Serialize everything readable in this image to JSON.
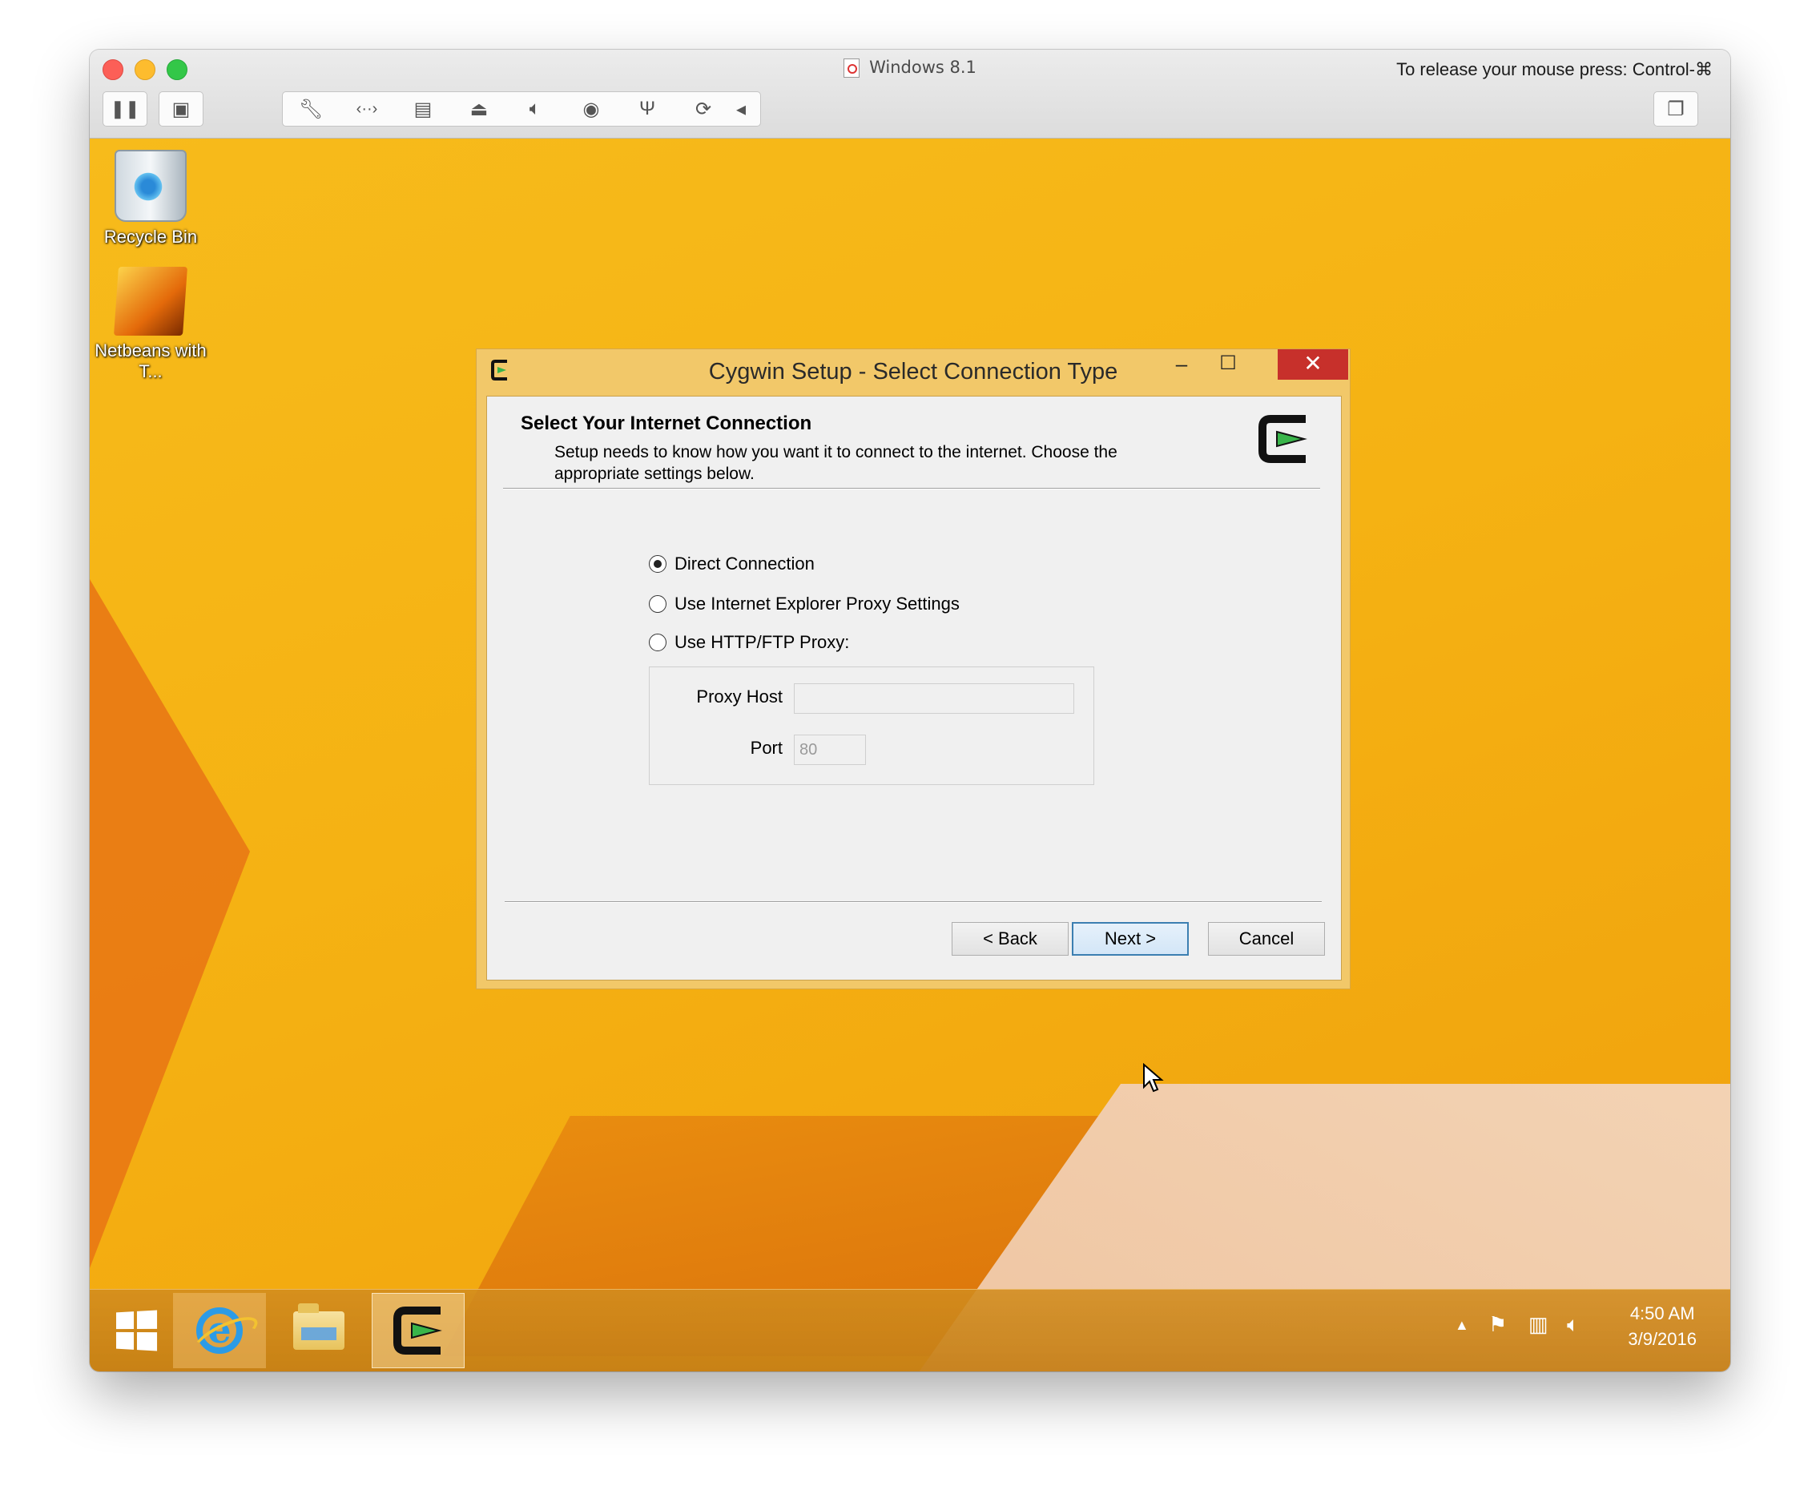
{
  "mac_window": {
    "title": "Windows 8.1",
    "release_hint": "To release your mouse press: Control-⌘",
    "toolbar_icons": [
      "pause-icon",
      "snapshot-icon",
      "wrench-icon",
      "network-icon",
      "hard-disk-icon",
      "optical-drive-icon",
      "speaker-icon",
      "camera-icon",
      "usb-icon",
      "shared-folders-icon",
      "collapse-arrow-icon",
      "window-mode-icon"
    ]
  },
  "desktop": {
    "icons": [
      {
        "label": "Recycle Bin",
        "icon": "recycle-bin-icon"
      },
      {
        "label": "Netbeans with T...",
        "icon": "netbeans-icon"
      }
    ]
  },
  "dialog": {
    "title": "Cygwin Setup - Select Connection Type",
    "controls": {
      "minimize": "–",
      "maximize": "☐",
      "close": "✕"
    },
    "header_title": "Select Your Internet Connection",
    "header_desc": "Setup needs to know how you want it to connect to the internet.  Choose the appropriate settings below.",
    "options": [
      {
        "label": "Direct Connection",
        "selected": true
      },
      {
        "label": "Use Internet Explorer Proxy Settings",
        "selected": false
      },
      {
        "label": "Use HTTP/FTP Proxy:",
        "selected": false
      }
    ],
    "proxy_host_label": "Proxy Host",
    "proxy_host_value": "",
    "port_label": "Port",
    "port_value": "80",
    "buttons": {
      "back": "< Back",
      "next": "Next >",
      "cancel": "Cancel"
    }
  },
  "taskbar": {
    "apps": [
      "internet-explorer-icon",
      "file-explorer-icon",
      "cygwin-icon"
    ],
    "active_app": "cygwin-icon",
    "tray_icons": [
      "show-hidden-icons-icon",
      "action-center-flag-icon",
      "network-icon",
      "volume-icon"
    ],
    "time": "4:50 AM",
    "date": "3/9/2016"
  },
  "colors": {
    "desktop_accent": "#f5b213",
    "dialog_frame": "#f2c869",
    "close_button": "#c7302b",
    "primary_button_border": "#3c7fb1"
  }
}
